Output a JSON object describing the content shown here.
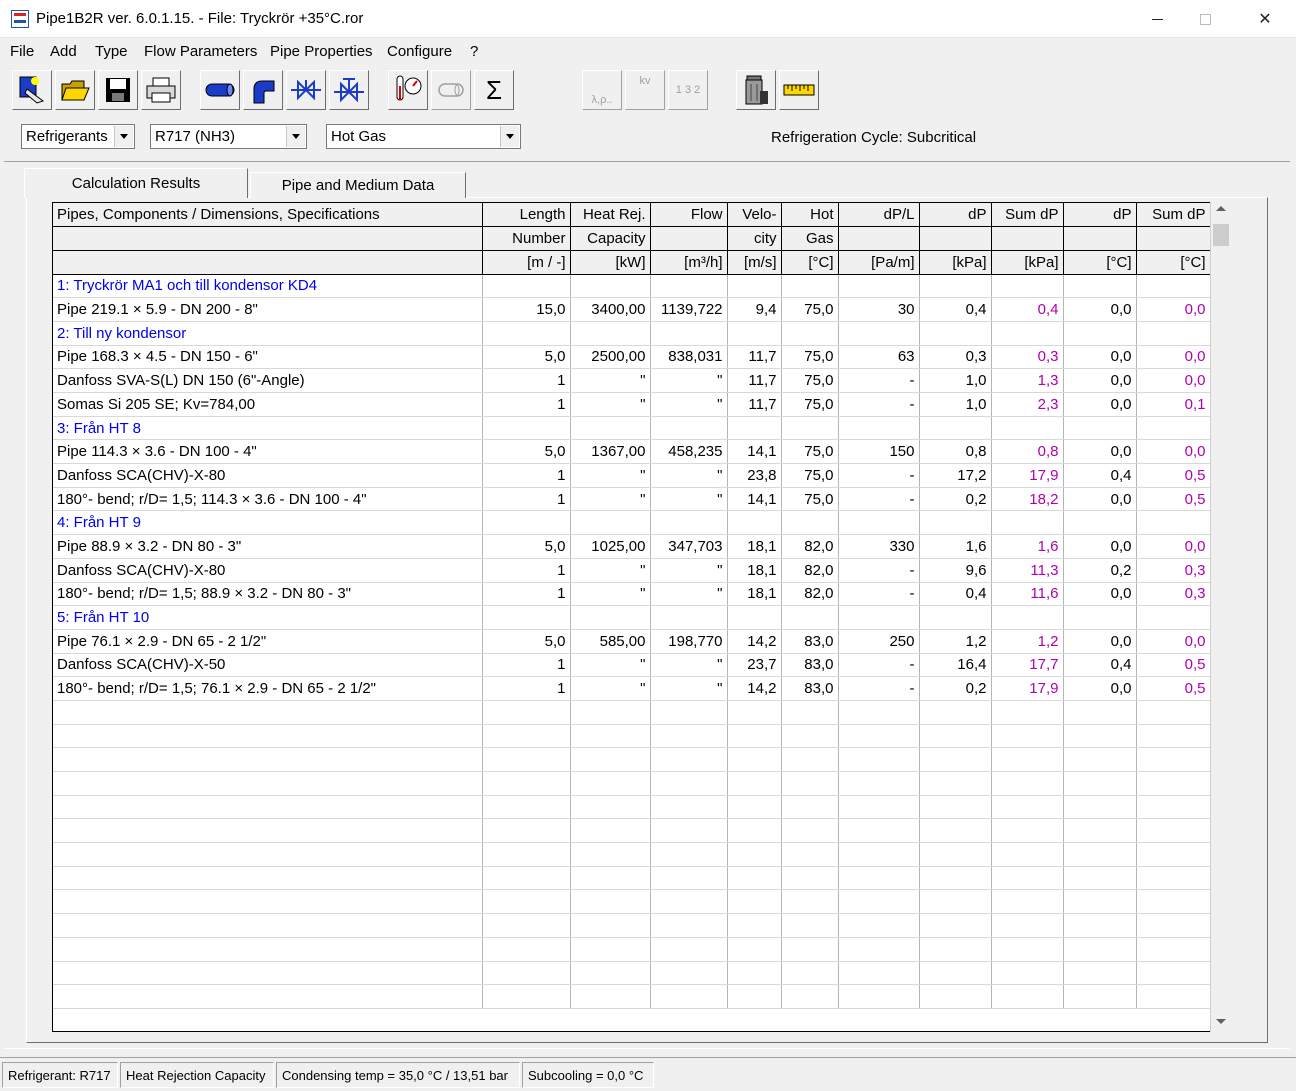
{
  "window": {
    "title": "Pipe1B2R ver. 6.0.1.15. - File: Tryckrör +35°C.ror",
    "close_glyph": "✕"
  },
  "menu": {
    "items": [
      "File",
      "Add",
      "Type",
      "Flow Parameters",
      "Pipe Properties",
      "Configure",
      "?"
    ]
  },
  "toolbar": {
    "buttons": [
      {
        "icon": "new-file-icon",
        "enabled": true
      },
      {
        "icon": "open-folder-icon",
        "enabled": true
      },
      {
        "icon": "save-disk-icon",
        "enabled": true
      },
      {
        "icon": "printer-icon",
        "enabled": true
      },
      {
        "icon": "pipe-icon",
        "enabled": true
      },
      {
        "icon": "pipe-bend-icon",
        "enabled": true
      },
      {
        "icon": "valve-icon",
        "enabled": true
      },
      {
        "icon": "valve-actuated-icon",
        "enabled": true
      },
      {
        "icon": "thermometer-gauge-icon",
        "enabled": true
      },
      {
        "icon": "insulation-icon",
        "enabled": false
      },
      {
        "icon": "sum-icon",
        "enabled": true,
        "label": "Σ"
      },
      {
        "icon": "lambda-rho-icon",
        "enabled": false,
        "label": "λ,ρ.."
      },
      {
        "icon": "kv-icon",
        "enabled": false,
        "label": "kv"
      },
      {
        "icon": "numbering-icon",
        "enabled": false,
        "label": "1 3 2"
      },
      {
        "icon": "trash-bin-icon",
        "enabled": true
      },
      {
        "icon": "ruler-icon",
        "enabled": true
      }
    ]
  },
  "selectors": {
    "category": "Refrigerants",
    "refrigerant": "R717 (NH3)",
    "line_type": "Hot Gas"
  },
  "cycle": {
    "label": "Refrigeration Cycle:",
    "value": "Subcritical"
  },
  "tabs": {
    "active": "Calculation Results",
    "inactive": "Pipe and Medium Data"
  },
  "table": {
    "header_rows": [
      [
        "Pipes, Components / Dimensions, Specifications",
        "Length",
        "Heat Rej.",
        "Flow",
        "Velo-",
        "Hot",
        "dP/L",
        "dP",
        "Sum dP",
        "dP",
        "Sum dP"
      ],
      [
        "",
        "Number",
        "Capacity",
        "",
        "city",
        "Gas",
        "",
        "",
        "",
        "",
        ""
      ],
      [
        "",
        "[m / -]",
        "[kW]",
        "[m³/h]",
        "[m/s]",
        "[°C]",
        "[Pa/m]",
        "[kPa]",
        "[kPa]",
        "[°C]",
        "[°C]"
      ]
    ],
    "rows": [
      {
        "group": true,
        "cells": [
          "1: Tryckrör MA1 och till kondensor KD4",
          "",
          "",
          "",
          "",
          "",
          "",
          "",
          "",
          "",
          ""
        ]
      },
      {
        "group": false,
        "cells": [
          "Pipe 219.1 × 5.9 - DN 200 - 8\"",
          "15,0",
          "3400,00",
          "1139,722",
          "9,4",
          "75,0",
          "30",
          "0,4",
          "0,4",
          "0,0",
          "0,0"
        ]
      },
      {
        "group": true,
        "cells": [
          "2: Till ny kondensor",
          "",
          "",
          "",
          "",
          "",
          "",
          "",
          "",
          "",
          ""
        ]
      },
      {
        "group": false,
        "cells": [
          "Pipe 168.3 × 4.5 - DN 150 - 6\"",
          "5,0",
          "2500,00",
          "838,031",
          "11,7",
          "75,0",
          "63",
          "0,3",
          "0,3",
          "0,0",
          "0,0"
        ]
      },
      {
        "group": false,
        "cells": [
          "Danfoss SVA-S(L) DN 150 (6\"-Angle)",
          "1",
          "\"",
          "\"",
          "11,7",
          "75,0",
          "-",
          "1,0",
          "1,3",
          "0,0",
          "0,0"
        ]
      },
      {
        "group": false,
        "cells": [
          "Somas Si 205 SE; Kv=784,00",
          "1",
          "\"",
          "\"",
          "11,7",
          "75,0",
          "-",
          "1,0",
          "2,3",
          "0,0",
          "0,1"
        ]
      },
      {
        "group": true,
        "cells": [
          "3: Från HT 8",
          "",
          "",
          "",
          "",
          "",
          "",
          "",
          "",
          "",
          ""
        ]
      },
      {
        "group": false,
        "cells": [
          "Pipe 114.3 × 3.6 - DN 100 - 4\"",
          "5,0",
          "1367,00",
          "458,235",
          "14,1",
          "75,0",
          "150",
          "0,8",
          "0,8",
          "0,0",
          "0,0"
        ]
      },
      {
        "group": false,
        "cells": [
          "Danfoss SCA(CHV)-X-80",
          "1",
          "\"",
          "\"",
          "23,8",
          "75,0",
          "-",
          "17,2",
          "17,9",
          "0,4",
          "0,5"
        ]
      },
      {
        "group": false,
        "cells": [
          "180°- bend; r/D= 1,5; 114.3 × 3.6 - DN 100 - 4\"",
          "1",
          "\"",
          "\"",
          "14,1",
          "75,0",
          "-",
          "0,2",
          "18,2",
          "0,0",
          "0,5"
        ]
      },
      {
        "group": true,
        "cells": [
          "4: Från HT 9",
          "",
          "",
          "",
          "",
          "",
          "",
          "",
          "",
          "",
          ""
        ]
      },
      {
        "group": false,
        "cells": [
          "Pipe 88.9 × 3.2 - DN 80 - 3\"",
          "5,0",
          "1025,00",
          "347,703",
          "18,1",
          "82,0",
          "330",
          "1,6",
          "1,6",
          "0,0",
          "0,0"
        ]
      },
      {
        "group": false,
        "cells": [
          "Danfoss SCA(CHV)-X-80",
          "1",
          "\"",
          "\"",
          "18,1",
          "82,0",
          "-",
          "9,6",
          "11,3",
          "0,2",
          "0,3"
        ]
      },
      {
        "group": false,
        "cells": [
          "180°- bend; r/D= 1,5; 88.9 × 3.2 - DN 80 - 3\"",
          "1",
          "\"",
          "\"",
          "18,1",
          "82,0",
          "-",
          "0,4",
          "11,6",
          "0,0",
          "0,3"
        ]
      },
      {
        "group": true,
        "cells": [
          "5: Från HT 10",
          "",
          "",
          "",
          "",
          "",
          "",
          "",
          "",
          "",
          ""
        ]
      },
      {
        "group": false,
        "cells": [
          "Pipe 76.1 × 2.9 - DN 65 - 2 1/2\"",
          "5,0",
          "585,00",
          "198,770",
          "14,2",
          "83,0",
          "250",
          "1,2",
          "1,2",
          "0,0",
          "0,0"
        ]
      },
      {
        "group": false,
        "cells": [
          "Danfoss SCA(CHV)-X-50",
          "1",
          "\"",
          "\"",
          "23,7",
          "83,0",
          "-",
          "16,4",
          "17,7",
          "0,4",
          "0,5"
        ]
      },
      {
        "group": false,
        "cells": [
          "180°- bend; r/D= 1,5; 76.1 × 2.9 - DN 65 - 2 1/2\"",
          "1",
          "\"",
          "\"",
          "14,2",
          "83,0",
          "-",
          "0,2",
          "17,9",
          "0,0",
          "0,5"
        ]
      }
    ],
    "empty_rows": 13
  },
  "status": {
    "refrigerant": "Refrigerant: R717",
    "mode": "Heat Rejection Capacity",
    "condensing": "Condensing temp = 35,0 °C / 13,51 bar",
    "subcooling": "Subcooling = 0,0 °C"
  },
  "colors": {
    "group_text": "#0000ee",
    "sum_text": "#b000b0"
  }
}
